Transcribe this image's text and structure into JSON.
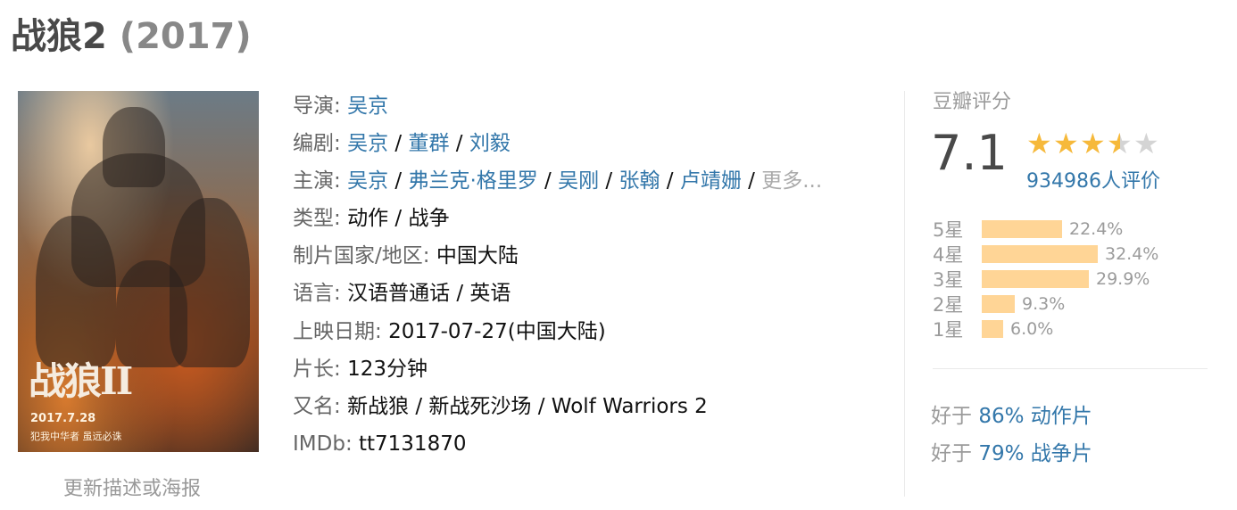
{
  "movie": {
    "title": "战狼2",
    "year": "(2017)"
  },
  "poster": {
    "logo_text": "战狼II",
    "date_text": "2017.7.28",
    "slogan_text": "犯我中华者 虽远必诛",
    "update_link": "更新描述或海报"
  },
  "info": {
    "director": {
      "label": "导演:",
      "names": [
        "吴京"
      ]
    },
    "writer": {
      "label": "编剧:",
      "names": [
        "吴京",
        "董群",
        "刘毅"
      ]
    },
    "cast": {
      "label": "主演:",
      "names": [
        "吴京",
        "弗兰克·格里罗",
        "吴刚",
        "张翰",
        "卢靖姗"
      ],
      "more": "更多..."
    },
    "genre": {
      "label": "类型:",
      "values": [
        "动作",
        "战争"
      ]
    },
    "country": {
      "label": "制片国家/地区:",
      "value": "中国大陆"
    },
    "language": {
      "label": "语言:",
      "value": "汉语普通话 / 英语"
    },
    "release": {
      "label": "上映日期:",
      "value": "2017-07-27(中国大陆)"
    },
    "runtime": {
      "label": "片长:",
      "value": "123分钟"
    },
    "aka": {
      "label": "又名:",
      "value": "新战狼 / 新战死沙场 / Wolf Warriors 2"
    },
    "imdb": {
      "label": "IMDb:",
      "value": "tt7131870"
    }
  },
  "rating": {
    "title": "豆瓣评分",
    "score": "7.1",
    "stars": 3.5,
    "votes": "934986人评价",
    "distribution": [
      {
        "label": "5星",
        "pct": "22.4%",
        "value": 22.4
      },
      {
        "label": "4星",
        "pct": "32.4%",
        "value": 32.4
      },
      {
        "label": "3星",
        "pct": "29.9%",
        "value": 29.9
      },
      {
        "label": "2星",
        "pct": "9.3%",
        "value": 9.3
      },
      {
        "label": "1星",
        "pct": "6.0%",
        "value": 6.0
      }
    ],
    "better_than": [
      {
        "prefix": "好于",
        "link": "86% 动作片"
      },
      {
        "prefix": "好于",
        "link": "79% 战争片"
      }
    ]
  },
  "colors": {
    "link": "#3377aa",
    "bar": "#ffd596",
    "star": "#f6b93b"
  }
}
